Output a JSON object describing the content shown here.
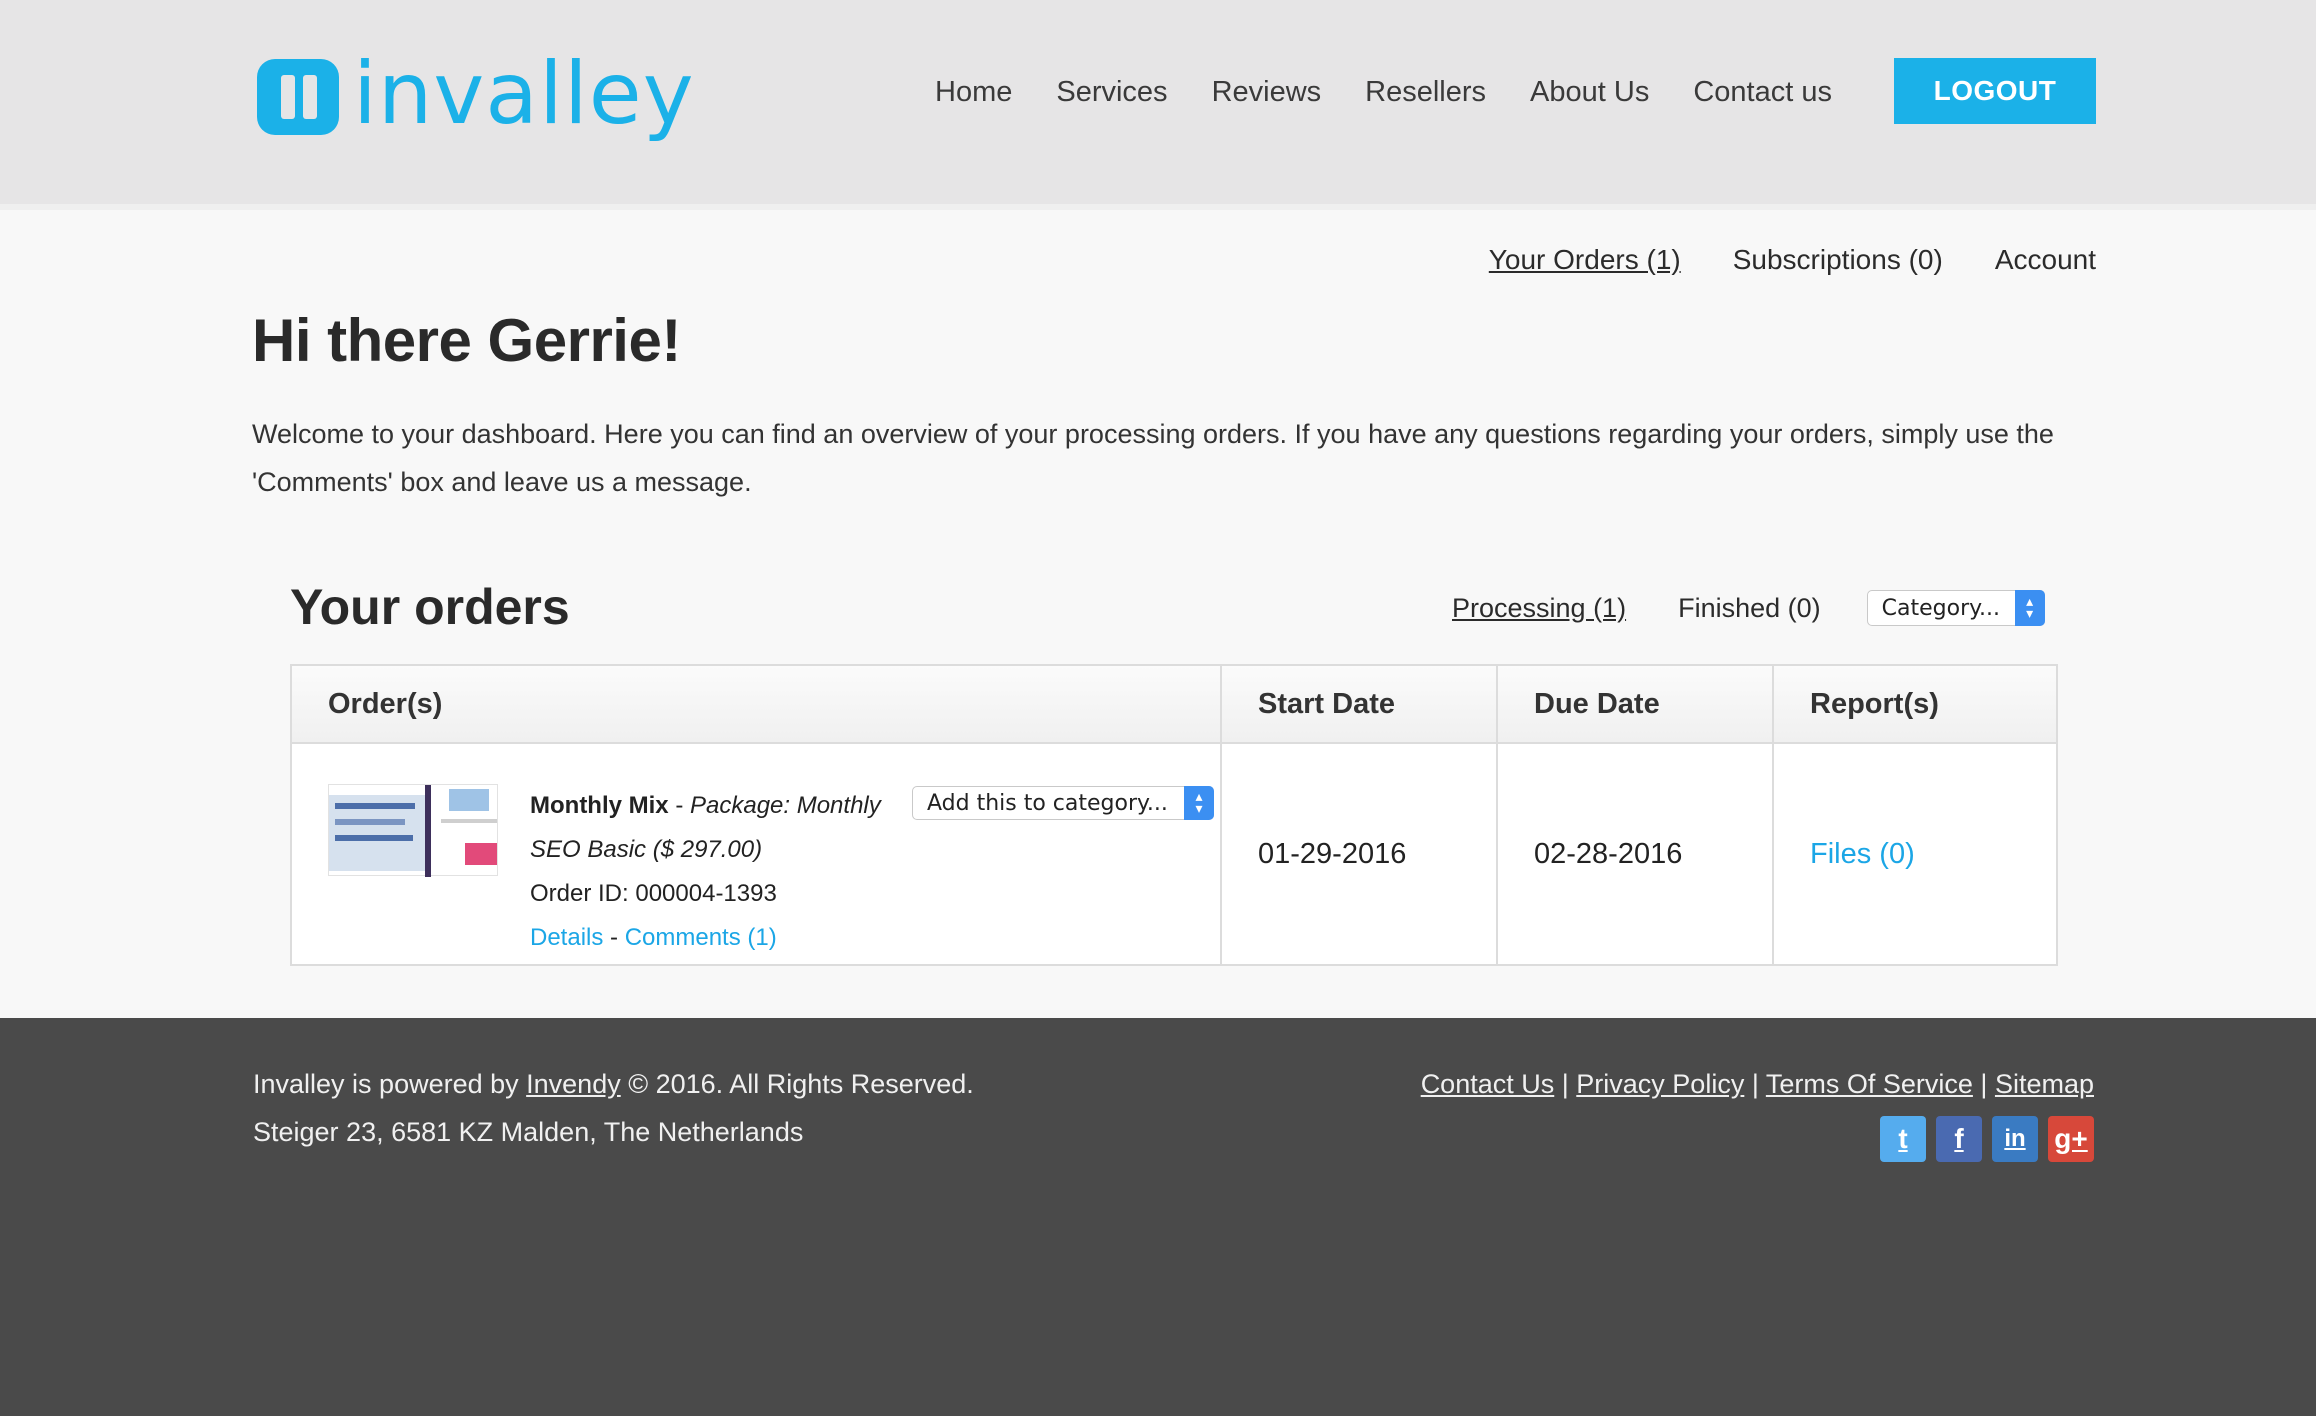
{
  "brand": {
    "name": "invalley",
    "color": "#1bb1e8"
  },
  "nav": {
    "items": [
      "Home",
      "Services",
      "Reviews",
      "Resellers",
      "About Us",
      "Contact us"
    ],
    "logout": "LOGOUT"
  },
  "subnav": {
    "orders": "Your Orders (1)",
    "subscriptions": "Subscriptions (0)",
    "account": "Account"
  },
  "greeting": "Hi there Gerrie!",
  "welcome": "Welcome to your dashboard. Here you can find an overview of your processing orders. If you have any questions regarding your orders, simply use the 'Comments' box and leave us a message.",
  "orders": {
    "title": "Your orders",
    "filters": {
      "processing": "Processing (1)",
      "finished": "Finished (0)"
    },
    "category_select": "Category...",
    "columns": [
      "Order(s)",
      "Start Date",
      "Due Date",
      "Report(s)"
    ],
    "rows": [
      {
        "name": "Monthly Mix",
        "separator": " - ",
        "package": "Package: Monthly SEO Basic ($ 297.00)",
        "order_id": "Order ID: 000004-1393",
        "details": "Details",
        "link_sep": " - ",
        "comments": "Comments (1)",
        "add_category": "Add this to category...",
        "start_date": "01-29-2016",
        "due_date": "02-28-2016",
        "reports": "Files (0)"
      }
    ]
  },
  "footer": {
    "powered_prefix": "Invalley is powered by ",
    "powered_link": "Invendy",
    "powered_suffix": " © 2016. All Rights Reserved.",
    "address": "Steiger 23, 6581 KZ Malden, The Netherlands",
    "links": [
      "Contact Us",
      "Privacy Policy",
      "Terms Of Service",
      "Sitemap"
    ],
    "link_sep": " | ",
    "social": [
      {
        "icon": "twitter-icon",
        "glyph": "t"
      },
      {
        "icon": "facebook-icon",
        "glyph": "f"
      },
      {
        "icon": "linkedin-icon",
        "glyph": "in"
      },
      {
        "icon": "google-plus-icon",
        "glyph": "g+"
      }
    ]
  }
}
